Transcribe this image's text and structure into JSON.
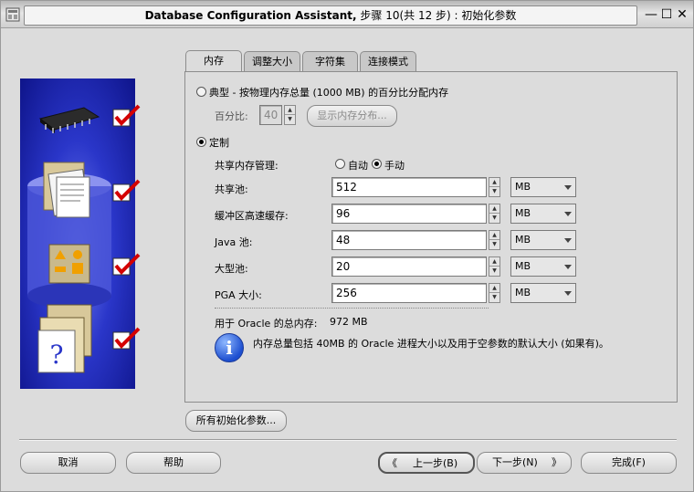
{
  "window": {
    "title_en": "Database Configuration Assistant,",
    "title_zh": " 步骤 10(共 12 步) : 初始化参数",
    "minimize_glyph": "—",
    "maximize_glyph": "☐",
    "close_glyph": "✕"
  },
  "tabs": [
    {
      "label": "内存",
      "active": true
    },
    {
      "label": "调整大小",
      "active": false
    },
    {
      "label": "字符集",
      "active": false
    },
    {
      "label": "连接模式",
      "active": false
    }
  ],
  "memory": {
    "typical_label": "典型 - 按物理内存总量 (1000 MB) 的百分比分配内存",
    "percent_label": "百分比:",
    "percent_value": "40",
    "show_distribution_button": "显示内存分布...",
    "custom_label": "定制",
    "shared_mgmt_label": "共享内存管理:",
    "auto_label": "自动",
    "manual_label": "手动",
    "pools": [
      {
        "label": "共享池:",
        "value": "512",
        "unit": "MB"
      },
      {
        "label": "缓冲区高速缓存:",
        "value": "96",
        "unit": "MB"
      },
      {
        "label": "Java 池:",
        "value": "48",
        "unit": "MB"
      },
      {
        "label": "大型池:",
        "value": "20",
        "unit": "MB"
      },
      {
        "label": "PGA 大小:",
        "value": "256",
        "unit": "MB"
      }
    ],
    "total_label": "用于 Oracle 的总内存:",
    "total_value": "972 MB",
    "info_text": "内存总量包括 40MB 的 Oracle 进程大小以及用于空参数的默认大小 (如果有)。",
    "info_glyph": "i"
  },
  "all_params_button": "所有初始化参数...",
  "footer": {
    "cancel": "取消",
    "help": "帮助",
    "back": "上一步(B)",
    "next": "下一步(N)",
    "finish": "完成(F)",
    "back_arrow": "《",
    "next_arrow": "》"
  }
}
